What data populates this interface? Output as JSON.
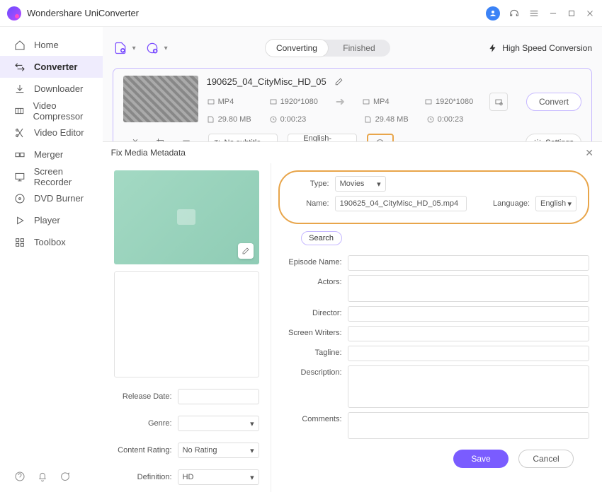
{
  "app": {
    "title": "Wondershare UniConverter"
  },
  "sidebar": {
    "items": [
      {
        "label": "Home"
      },
      {
        "label": "Converter"
      },
      {
        "label": "Downloader"
      },
      {
        "label": "Video Compressor"
      },
      {
        "label": "Video Editor"
      },
      {
        "label": "Merger"
      },
      {
        "label": "Screen Recorder"
      },
      {
        "label": "DVD Burner"
      },
      {
        "label": "Player"
      },
      {
        "label": "Toolbox"
      }
    ]
  },
  "tabs": {
    "converting": "Converting",
    "finished": "Finished",
    "hsc": "High Speed Conversion"
  },
  "file": {
    "name": "190625_04_CityMisc_HD_05",
    "src": {
      "format": "MP4",
      "resolution": "1920*1080",
      "size": "29.80 MB",
      "duration": "0:00:23"
    },
    "dst": {
      "format": "MP4",
      "resolution": "1920*1080",
      "size": "29.48 MB",
      "duration": "0:00:23"
    },
    "subtitle": "No subtitle",
    "audio": "English-Advan...",
    "convert": "Convert",
    "settings": "Settings"
  },
  "modal": {
    "title": "Fix Media Metadata",
    "type_label": "Type:",
    "type_value": "Movies",
    "name_label": "Name:",
    "name_value": "190625_04_CityMisc_HD_05.mp4",
    "lang_label": "Language:",
    "lang_value": "English",
    "search": "Search",
    "fields": {
      "episode": "Episode Name:",
      "actors": "Actors:",
      "director": "Director:",
      "writers": "Screen Writers:",
      "tagline": "Tagline:",
      "description": "Description:",
      "comments": "Comments:"
    },
    "left": {
      "release": "Release Date:",
      "genre": "Genre:",
      "rating_label": "Content Rating:",
      "rating_value": "No Rating",
      "def_label": "Definition:",
      "def_value": "HD"
    },
    "save": "Save",
    "cancel": "Cancel"
  }
}
